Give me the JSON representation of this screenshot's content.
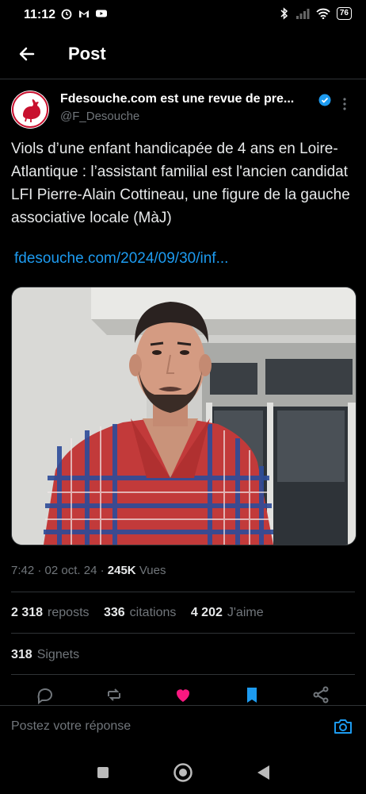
{
  "status_bar": {
    "time": "11:12",
    "battery": "76",
    "left_icons": [
      "alarm-icon",
      "gmail-icon",
      "youtube-icon"
    ],
    "right_icons": [
      "bluetooth-icon",
      "signal-icon",
      "wifi-icon",
      "battery-icon"
    ]
  },
  "header": {
    "title": "Post"
  },
  "author": {
    "name": "Fdesouche.com est une revue de pre...",
    "handle": "@F_Desouche",
    "verified": true
  },
  "tweet": {
    "text": "Viols d’une enfant handicapée de 4 ans en Loire-Atlantique : l’assistant familial est l'ancien candidat LFI Pierre-Alain Cottineau, une figure de la gauche associative locale (MàJ)",
    "link": "fdesouche.com/2024/09/30/inf..."
  },
  "meta": {
    "time": "7:42",
    "date": "02 oct. 24",
    "views_count": "245K",
    "views_label": "Vues"
  },
  "stats": {
    "reposts_count": "2 318",
    "reposts_label": "reposts",
    "quotes_count": "336",
    "quotes_label": "citations",
    "likes_count": "4 202",
    "likes_label": "J'aime",
    "bookmarks_count": "318",
    "bookmarks_label": "Signets"
  },
  "actions": [
    "reply-icon",
    "repost-icon",
    "like-icon",
    "bookmark-icon",
    "share-icon"
  ],
  "reply_bar": {
    "placeholder": "Postez votre réponse"
  },
  "colors": {
    "background": "#000000",
    "accent": "#1d9bf0",
    "like": "#f91880",
    "muted": "#71767b",
    "divider": "#2f3336"
  }
}
